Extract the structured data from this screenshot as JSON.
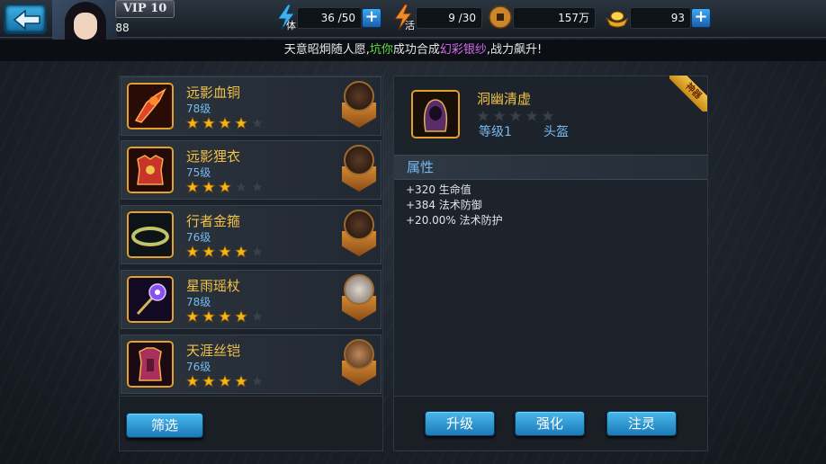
{
  "header": {
    "vip_label": "VIP 10",
    "player_level": "88",
    "stamina": {
      "label": "体",
      "value": "36 /50"
    },
    "activity": {
      "label": "活",
      "value": "9 /30"
    },
    "coins": {
      "value": "157万"
    },
    "gold": {
      "value": "93"
    }
  },
  "marquee": {
    "prefix": "天意昭炯随人愿,",
    "player": "坑你",
    "middle": "成功合成",
    "item": "幻彩银纱",
    "suffix": ",战力飙升!"
  },
  "equipment_list": [
    {
      "name": "远影血铜",
      "level": "78级",
      "stars": 4,
      "max_stars": 5,
      "icon": "flame-claw-icon",
      "hero_icon": "dark-beast-hero-icon"
    },
    {
      "name": "远影狸衣",
      "level": "75级",
      "stars": 3,
      "max_stars": 5,
      "icon": "red-armor-icon",
      "hero_icon": "dark-beast-hero-icon"
    },
    {
      "name": "行者金箍",
      "level": "76级",
      "stars": 4,
      "max_stars": 5,
      "icon": "golden-circlet-icon",
      "hero_icon": "dark-beast-hero-icon"
    },
    {
      "name": "星雨瑶杖",
      "level": "78级",
      "stars": 4,
      "max_stars": 5,
      "icon": "star-staff-icon",
      "hero_icon": "silver-hair-hero-icon"
    },
    {
      "name": "天涯丝铠",
      "level": "76级",
      "stars": 4,
      "max_stars": 5,
      "icon": "silk-armor-icon",
      "hero_icon": "warrior-hero-icon"
    }
  ],
  "filter_button": "筛选",
  "detail": {
    "name": "洞幽清虚",
    "stars": 0,
    "max_stars": 5,
    "level": "等级1",
    "slot_type": "头盔",
    "ribbon": "神器",
    "icon": "hooded-helm-icon",
    "attributes_title": "属性",
    "attributes": [
      "+320 生命值",
      "+384 法术防御",
      "+20.00% 法术防护"
    ]
  },
  "actions": {
    "upgrade": "升级",
    "enhance": "强化",
    "infuse": "注灵"
  },
  "colors": {
    "item_name": "#f1c148",
    "level_text": "#77b9f0",
    "button_blue": "#2a93d1",
    "star_gold": "#f2b51c",
    "marquee_player": "#5ce040",
    "marquee_item": "#d56bf2"
  }
}
